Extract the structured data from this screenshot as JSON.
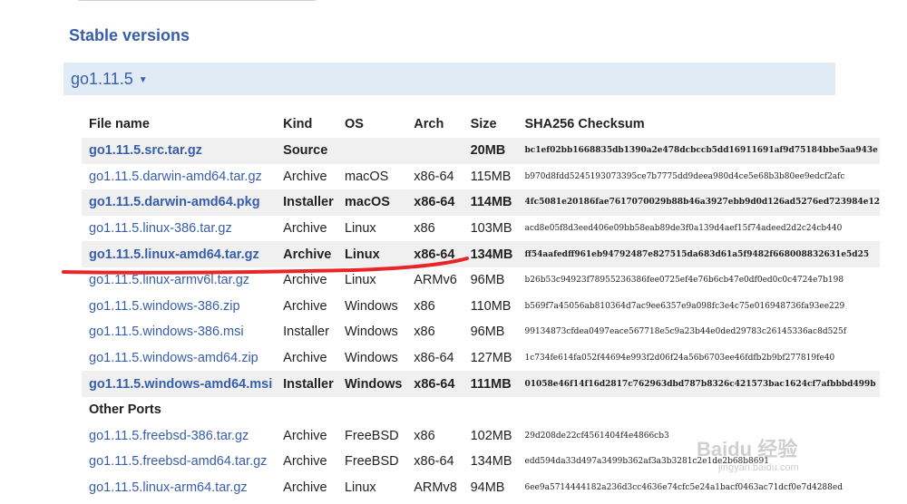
{
  "section_title": "Stable versions",
  "version": {
    "label": "go1.11.5"
  },
  "table": {
    "headers": {
      "file": "File name",
      "kind": "Kind",
      "os": "OS",
      "arch": "Arch",
      "size": "Size",
      "sha": "SHA256 Checksum"
    },
    "rows": [
      {
        "file": "go1.11.5.src.tar.gz",
        "kind": "Source",
        "os": "",
        "arch": "",
        "size": "20MB",
        "sha": "bc1ef02bb1668835db1390a2e478dcbccb5dd16911691af9d75184bbe5aa943e",
        "highlight": true
      },
      {
        "file": "go1.11.5.darwin-amd64.tar.gz",
        "kind": "Archive",
        "os": "macOS",
        "arch": "x86-64",
        "size": "115MB",
        "sha": "b970d8fdd5245193073395ce7b7775dd9deea980d4ce5e68b3b80ee9edcf2afc",
        "highlight": false
      },
      {
        "file": "go1.11.5.darwin-amd64.pkg",
        "kind": "Installer",
        "os": "macOS",
        "arch": "x86-64",
        "size": "114MB",
        "sha": "4fc5081e20186fae7617070029b88b46a3927ebb9d0d126ad5276ed723984e12",
        "highlight": true
      },
      {
        "file": "go1.11.5.linux-386.tar.gz",
        "kind": "Archive",
        "os": "Linux",
        "arch": "x86",
        "size": "103MB",
        "sha": "acd8e05f8d3eed406e09bb58eab89de3f0a139d4aef15f74adeed2d2c24cb440",
        "highlight": false
      },
      {
        "file": "go1.11.5.linux-amd64.tar.gz",
        "kind": "Archive",
        "os": "Linux",
        "arch": "x86-64",
        "size": "134MB",
        "sha": "ff54aafedff961eb94792487e827515da683d61a5f9482f668008832631e5d25",
        "highlight": true
      },
      {
        "file": "go1.11.5.linux-armv6l.tar.gz",
        "kind": "Archive",
        "os": "Linux",
        "arch": "ARMv6",
        "size": "96MB",
        "sha": "b26b53c94923f78955236386fee0725ef4e76b6cb47e0df0ed0c0c4724e7b198",
        "highlight": false
      },
      {
        "file": "go1.11.5.windows-386.zip",
        "kind": "Archive",
        "os": "Windows",
        "arch": "x86",
        "size": "110MB",
        "sha": "b569f7a45056ab810364d7ac9ee6357e9a098fc3e4c75e016948736fa93ee229",
        "highlight": false
      },
      {
        "file": "go1.11.5.windows-386.msi",
        "kind": "Installer",
        "os": "Windows",
        "arch": "x86",
        "size": "96MB",
        "sha": "99134873cfdea0497eace567718e5c9a23b44e0ded29783c26145336ac8d525f",
        "highlight": false
      },
      {
        "file": "go1.11.5.windows-amd64.zip",
        "kind": "Archive",
        "os": "Windows",
        "arch": "x86-64",
        "size": "127MB",
        "sha": "1c734fe614fa052f44694e993f2d06f24a56b6703ee46fdfb2b9bf277819fe40",
        "highlight": false
      },
      {
        "file": "go1.11.5.windows-amd64.msi",
        "kind": "Installer",
        "os": "Windows",
        "arch": "x86-64",
        "size": "111MB",
        "sha": "01058e46f14f16d2817c762963dbd787b8326c421573bac1624cf7afbbbd499b",
        "highlight": true
      }
    ],
    "other_ports_label": "Other Ports",
    "other_rows": [
      {
        "file": "go1.11.5.freebsd-386.tar.gz",
        "kind": "Archive",
        "os": "FreeBSD",
        "arch": "x86",
        "size": "102MB",
        "sha": "29d208de22cf4561404f4e4866cb3"
      },
      {
        "file": "go1.11.5.freebsd-amd64.tar.gz",
        "kind": "Archive",
        "os": "FreeBSD",
        "arch": "x86-64",
        "size": "134MB",
        "sha": "edd594da33d497a3499b362af3a3b3281c2e1de2b68b8691"
      },
      {
        "file": "go1.11.5.linux-arm64.tar.gz",
        "kind": "Archive",
        "os": "Linux",
        "arch": "ARMv8",
        "size": "94MB",
        "sha": "6ee9a5714444182a236d3cc4636e74cfc5e24a1bacf0463ac71dcf0e7d4288ed"
      }
    ]
  },
  "watermark": {
    "brand": "Baidu 经验",
    "sub": "jingyan.baidu.com"
  },
  "colors": {
    "link": "#375eab",
    "version_bar": "#e0ebf5",
    "highlight_row": "#f0f0f0",
    "annotation": "#e8262a"
  }
}
